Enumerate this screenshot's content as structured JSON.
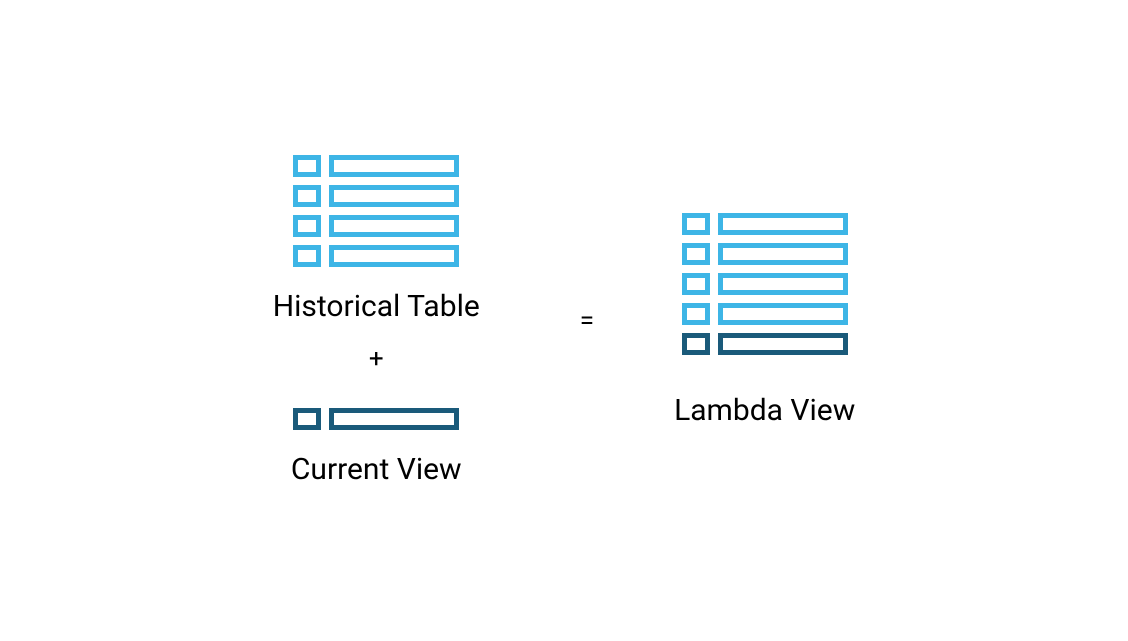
{
  "diagram": {
    "historical": {
      "label": "Historical Table",
      "rowCount": 4,
      "color": "light"
    },
    "operator_plus": "+",
    "current": {
      "label": "Current View",
      "rowCount": 1,
      "color": "dark"
    },
    "operator_equals": "=",
    "lambda": {
      "label": "Lambda View",
      "lightRowCount": 4,
      "darkRowCount": 1
    }
  },
  "colors": {
    "light": "#3db5e6",
    "dark": "#1a5a7a"
  }
}
